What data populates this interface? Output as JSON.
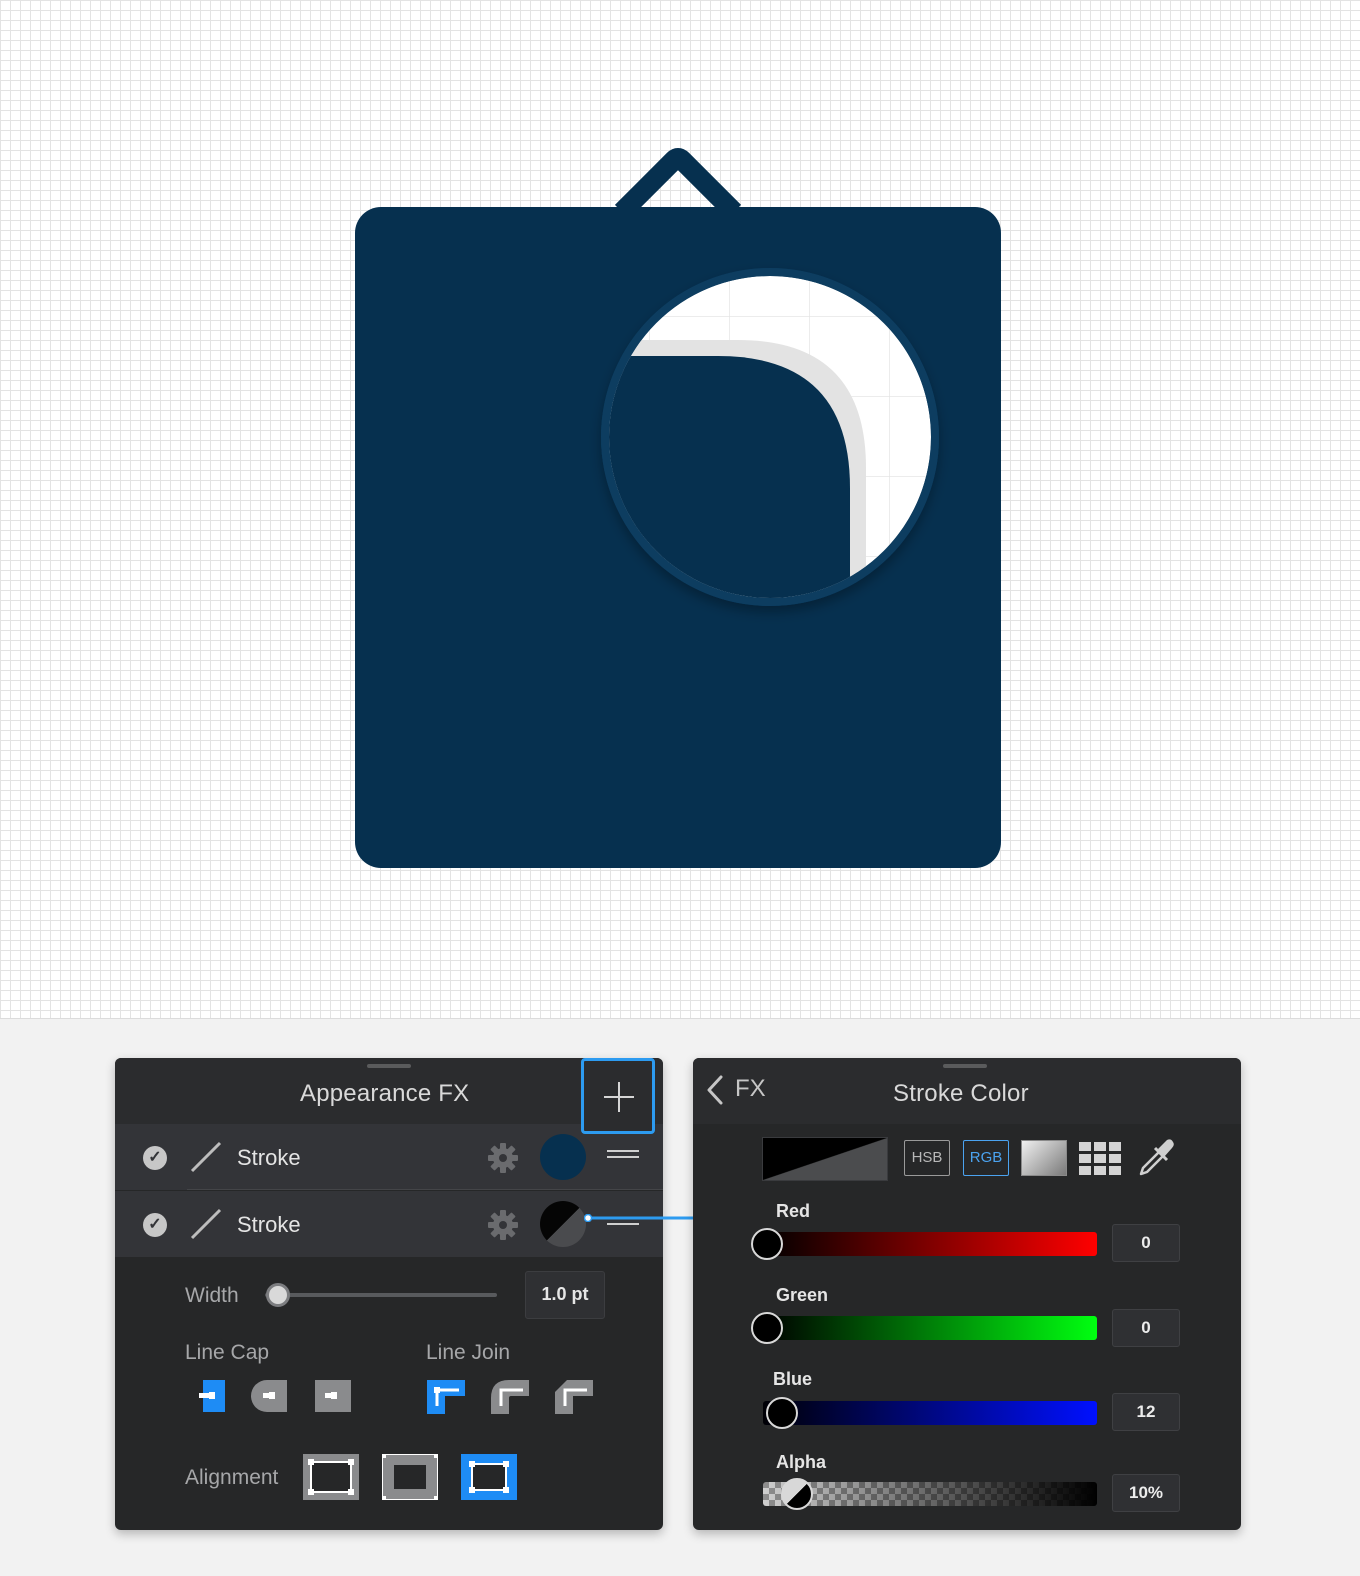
{
  "colors": {
    "artboard_background": "#ffffff",
    "icon_navy": "#06304f",
    "accent_blue": "#2d9bf0",
    "panel_background": "#262728"
  },
  "appearance_panel": {
    "title": "Appearance FX",
    "add_icon": "plus-icon",
    "layers": [
      {
        "label": "Stroke",
        "enabled": true,
        "icon": "stroke-slash-icon",
        "color": "#06304f"
      },
      {
        "label": "Stroke",
        "enabled": true,
        "icon": "stroke-slash-icon",
        "color": "#00000c"
      }
    ],
    "width": {
      "label": "Width",
      "value": "1.0 pt",
      "slider_fraction": 0.05
    },
    "line_cap": {
      "label": "Line Cap",
      "options": [
        "butt-cap-icon",
        "round-cap-icon",
        "square-cap-icon"
      ],
      "selected": 0
    },
    "line_join": {
      "label": "Line Join",
      "options": [
        "miter-join-icon",
        "round-join-icon",
        "bevel-join-icon"
      ],
      "selected": 0
    },
    "alignment": {
      "label": "Alignment",
      "options": [
        "align-center-icon",
        "align-inside-icon",
        "align-outside-icon"
      ],
      "selected": 2
    }
  },
  "stroke_color_panel": {
    "back_label": "FX",
    "title": "Stroke Color",
    "modes": {
      "hsb": "HSB",
      "rgb": "RGB",
      "selected": "RGB"
    },
    "channels": [
      {
        "label": "Red",
        "value": "0",
        "fraction": 0.0
      },
      {
        "label": "Green",
        "value": "0",
        "fraction": 0.0
      },
      {
        "label": "Blue",
        "value": "12",
        "fraction": 0.047
      },
      {
        "label": "Alpha",
        "value": "10%",
        "fraction": 0.1
      }
    ]
  }
}
